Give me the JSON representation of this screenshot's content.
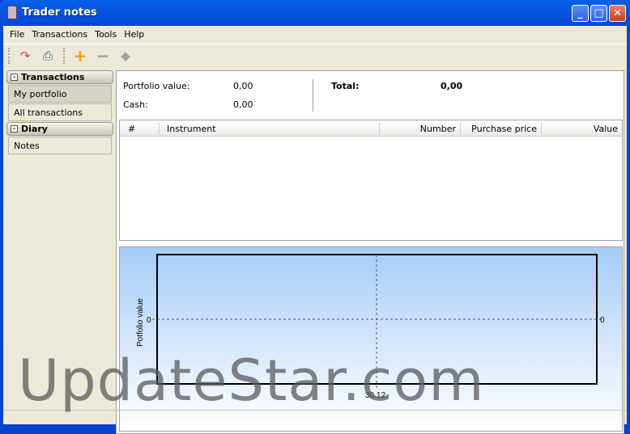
{
  "window": {
    "title": "Trader notes"
  },
  "menu": [
    "File",
    "Transactions",
    "Tools",
    "Help"
  ],
  "sidebar": {
    "groups": [
      {
        "label": "Transactions",
        "items": [
          "My portfolio",
          "All transactions"
        ]
      },
      {
        "label": "Diary",
        "items": [
          "Notes"
        ]
      }
    ]
  },
  "summary": {
    "portfolio_label": "Portfolio value:",
    "portfolio_value": "0,00",
    "cash_label": "Cash:",
    "cash_value": "0,00",
    "total_label": "Total:",
    "total_value": "0,00"
  },
  "table": {
    "columns": [
      "#",
      "Instrument",
      "Number",
      "Purchase price",
      "Value"
    ]
  },
  "chart_data": {
    "type": "line",
    "ylabel": "Potfolio value",
    "y_ticks_left": [
      "0"
    ],
    "y_ticks_right": [
      "0"
    ],
    "x_ticks": [
      "30.12"
    ],
    "series": [],
    "grid": true
  },
  "watermark": "UpdateStar.com"
}
